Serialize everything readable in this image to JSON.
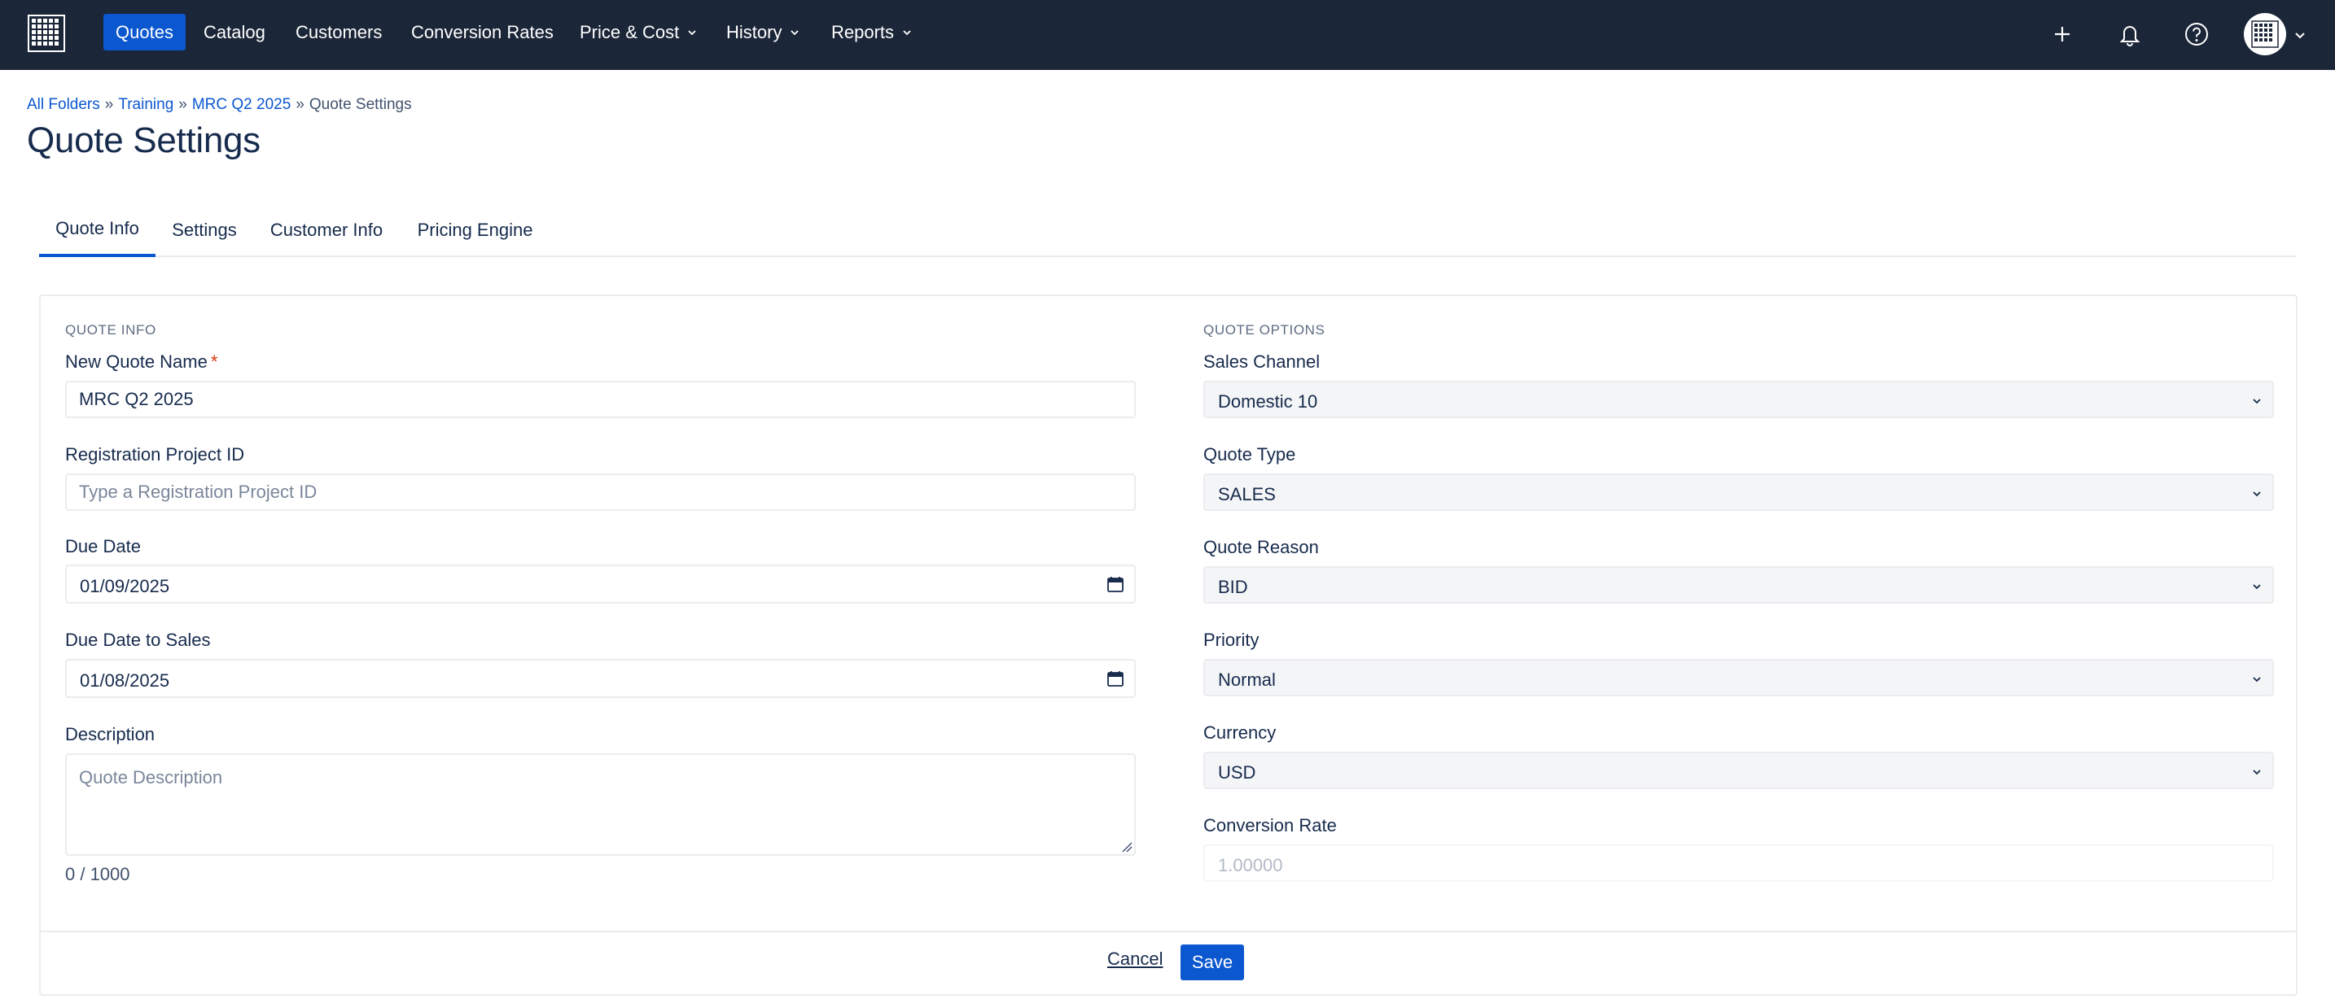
{
  "nav": {
    "items": [
      {
        "label": "Quotes",
        "active": true
      },
      {
        "label": "Catalog"
      },
      {
        "label": "Customers"
      },
      {
        "label": "Conversion Rates"
      },
      {
        "label": "Price & Cost",
        "dropdown": true
      },
      {
        "label": "History",
        "dropdown": true
      },
      {
        "label": "Reports",
        "dropdown": true
      }
    ],
    "icons": [
      "plus-icon",
      "bell-icon",
      "help-icon",
      "avatar-grid-icon",
      "chevron-down-icon"
    ],
    "colors": {
      "background": "#1b2638",
      "active": "#0b57d0"
    }
  },
  "breadcrumb": {
    "items": [
      "All Folders",
      "Training",
      "MRC Q2 2025"
    ],
    "current": "Quote Settings",
    "separator": "»"
  },
  "page": {
    "title": "Quote Settings"
  },
  "tabs": [
    {
      "label": "Quote Info",
      "active": true
    },
    {
      "label": "Settings"
    },
    {
      "label": "Customer Info"
    },
    {
      "label": "Pricing Engine"
    }
  ],
  "quote_info": {
    "section_title": "QUOTE INFO",
    "name": {
      "label": "New Quote Name",
      "required_mark": "*",
      "value": "MRC Q2 2025"
    },
    "registration": {
      "label": "Registration Project ID",
      "value": "",
      "placeholder": "Type a Registration Project ID"
    },
    "due_date": {
      "label": "Due Date",
      "value": "01/09/2025"
    },
    "due_date_sales": {
      "label": "Due Date to Sales",
      "value": "01/08/2025"
    },
    "description": {
      "label": "Description",
      "value": "",
      "placeholder": "Quote Description",
      "counter": "0 / 1000"
    }
  },
  "quote_options": {
    "section_title": "QUOTE OPTIONS",
    "sales_channel": {
      "label": "Sales Channel",
      "value": "Domestic 10"
    },
    "quote_type": {
      "label": "Quote Type",
      "value": "SALES"
    },
    "quote_reason": {
      "label": "Quote Reason",
      "value": "BID"
    },
    "priority": {
      "label": "Priority",
      "value": "Normal"
    },
    "currency": {
      "label": "Currency",
      "value": "USD"
    },
    "conversion_rate": {
      "label": "Conversion Rate",
      "value": "1.00000"
    }
  },
  "actions": {
    "cancel": "Cancel",
    "save": "Save"
  }
}
